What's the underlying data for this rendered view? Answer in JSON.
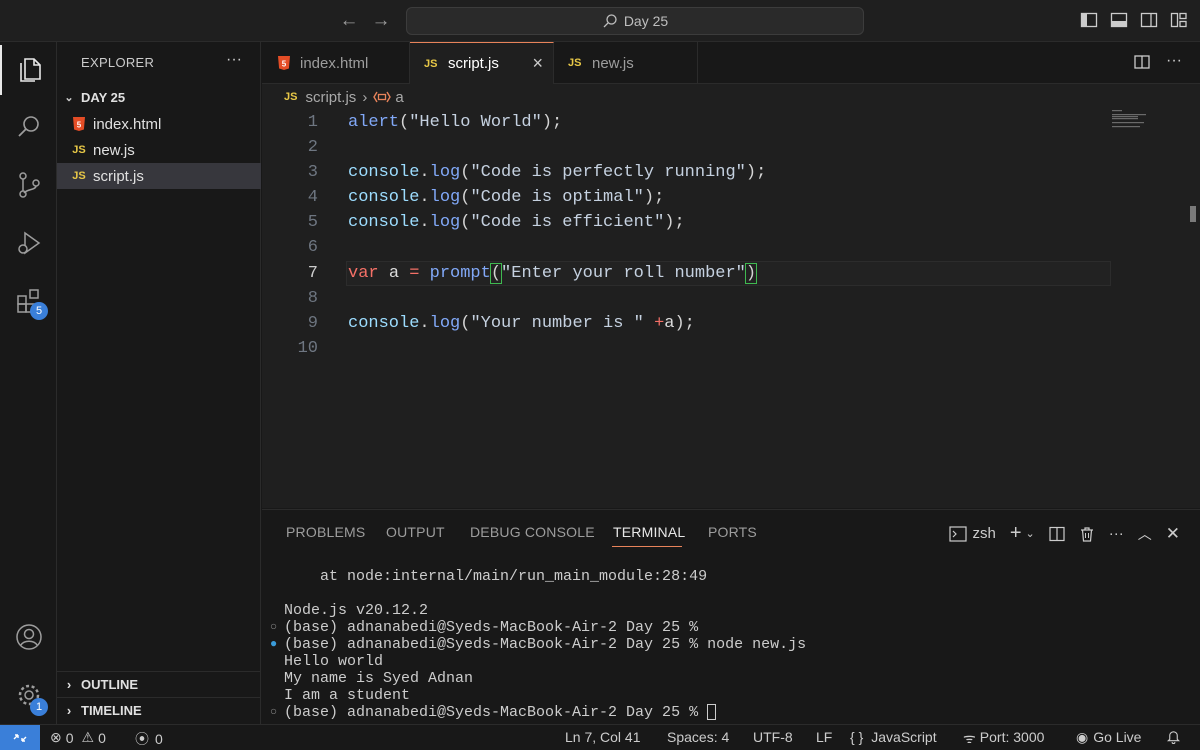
{
  "titlebar": {
    "search_text": "Day 25"
  },
  "activity": {
    "extensions_badge": "5",
    "settings_badge": "1"
  },
  "sidebar": {
    "title": "EXPLORER",
    "more": "···",
    "folder": "DAY 25",
    "files": [
      {
        "icon": "html5-icon",
        "name": "index.html"
      },
      {
        "icon": "js-icon",
        "name": "new.js"
      },
      {
        "icon": "js-icon",
        "name": "script.js"
      }
    ],
    "outline": "OUTLINE",
    "timeline": "TIMELINE"
  },
  "tabs": [
    {
      "icon": "html5-icon",
      "label": "index.html"
    },
    {
      "icon": "js-icon",
      "label": "script.js"
    },
    {
      "icon": "js-icon",
      "label": "new.js"
    }
  ],
  "js_label": "JS",
  "breadcrumb": {
    "file": "script.js",
    "symbol": "a"
  },
  "editor": {
    "line_numbers": [
      "1",
      "2",
      "3",
      "4",
      "5",
      "6",
      "7",
      "8",
      "9",
      "10"
    ],
    "current_line": 7
  },
  "panel": {
    "tabs": [
      "PROBLEMS",
      "OUTPUT",
      "DEBUG CONSOLE",
      "TERMINAL",
      "PORTS"
    ],
    "active_tab": "TERMINAL",
    "shell": "zsh",
    "terminal_lines": [
      "    at node:internal/main/run_main_module:28:49",
      "",
      "Node.js v20.12.2",
      "(base) adnanabedi@Syeds-MacBook-Air-2 Day 25 %",
      "(base) adnanabedi@Syeds-MacBook-Air-2 Day 25 % node new.js",
      "Hello world",
      "My name is Syed Adnan",
      "I am a student",
      "(base) adnanabedi@Syeds-MacBook-Air-2 Day 25 % "
    ]
  },
  "statusbar": {
    "errors": "0",
    "warnings": "0",
    "ports_forwarded": "0",
    "position": "Ln 7, Col 41",
    "spaces": "Spaces: 4",
    "encoding": "UTF-8",
    "eol": "LF",
    "language_braces": "{ }",
    "language": "JavaScript",
    "port": "Port: 3000",
    "golive": "Go Live"
  },
  "colors": {
    "accent": "#3a7fd9",
    "tab_active_border": "#e8835a",
    "js_yellow": "#e8c847",
    "html_orange": "#e44d26"
  }
}
